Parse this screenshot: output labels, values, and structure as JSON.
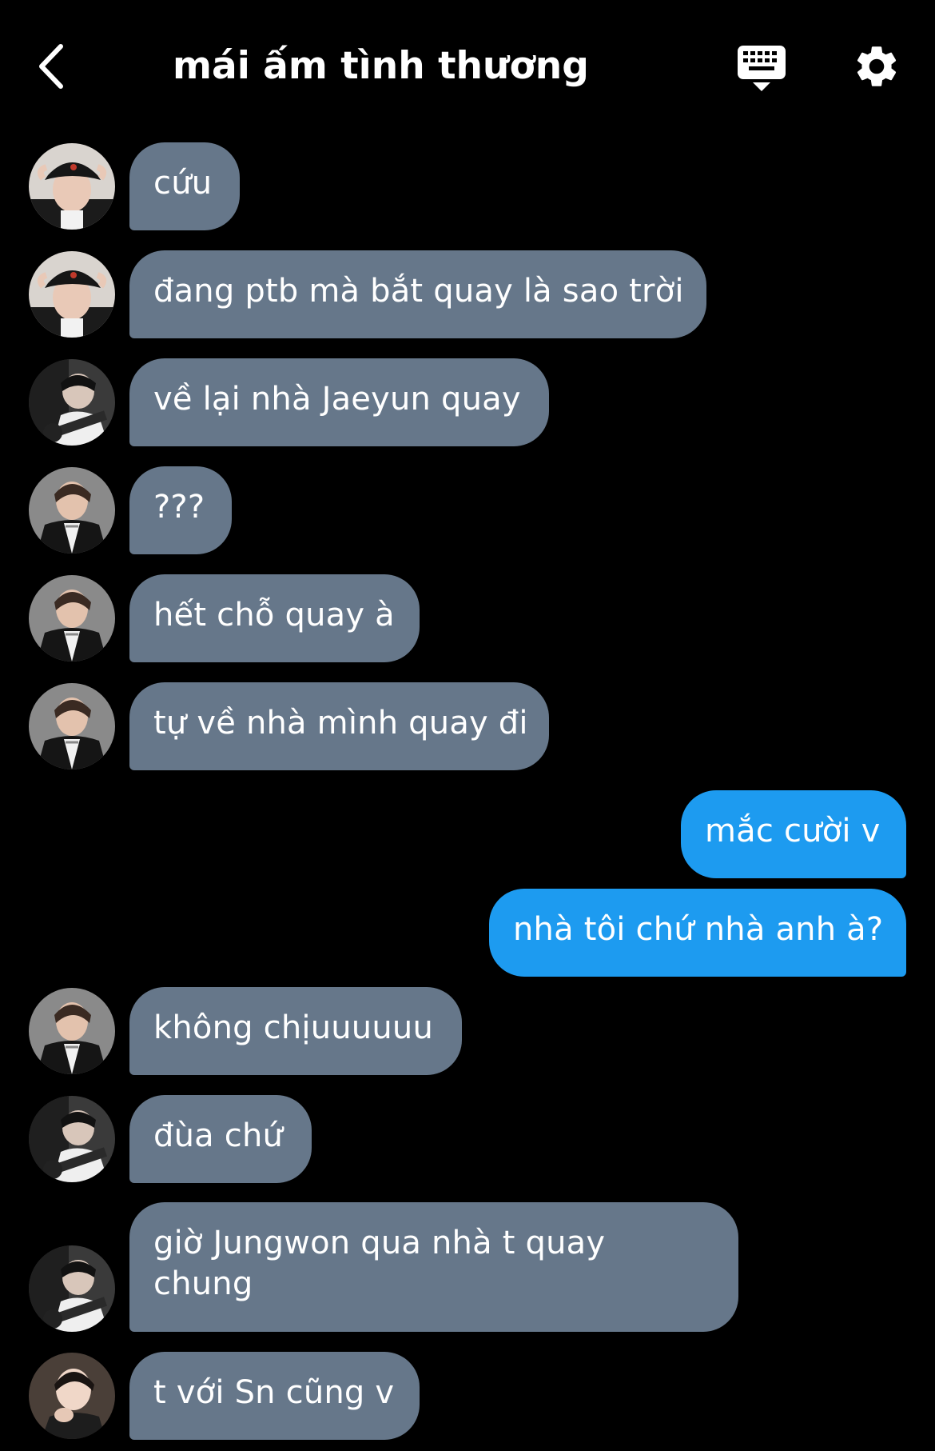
{
  "header": {
    "title": "mái ấm tình thương",
    "back_icon": "chevron-left-icon",
    "keyboard_icon": "keyboard-icon",
    "settings_icon": "gear-icon"
  },
  "colors": {
    "background": "#000000",
    "incoming_bubble": "#66778a",
    "outgoing_bubble": "#1d9bf0",
    "text": "#ffffff"
  },
  "messages": [
    {
      "direction": "incoming",
      "sender_avatar": "avatar-cap-user",
      "text": "cứu"
    },
    {
      "direction": "incoming",
      "sender_avatar": "avatar-cap-user",
      "text": "đang ptb mà bắt quay là sao trời"
    },
    {
      "direction": "incoming",
      "sender_avatar": "avatar-guitar-user",
      "text": "về lại nhà Jaeyun quay"
    },
    {
      "direction": "incoming",
      "sender_avatar": "avatar-leather-jacket-user",
      "text": "???"
    },
    {
      "direction": "incoming",
      "sender_avatar": "avatar-leather-jacket-user",
      "text": "hết chỗ quay à"
    },
    {
      "direction": "incoming",
      "sender_avatar": "avatar-leather-jacket-user",
      "text": "tự về nhà mình quay đi"
    },
    {
      "direction": "outgoing",
      "text": "mắc cười v"
    },
    {
      "direction": "outgoing",
      "text": "nhà tôi chứ nhà anh à?"
    },
    {
      "direction": "incoming",
      "sender_avatar": "avatar-leather-jacket-user",
      "text": "không chịuuuuuu"
    },
    {
      "direction": "incoming",
      "sender_avatar": "avatar-guitar-user",
      "text": "đùa chứ"
    },
    {
      "direction": "incoming",
      "sender_avatar": "avatar-guitar-user",
      "text": "giờ Jungwon qua nhà t quay chung"
    },
    {
      "direction": "incoming",
      "sender_avatar": "avatar-hand-chin-user",
      "text": "t với Sn cũng v"
    }
  ]
}
